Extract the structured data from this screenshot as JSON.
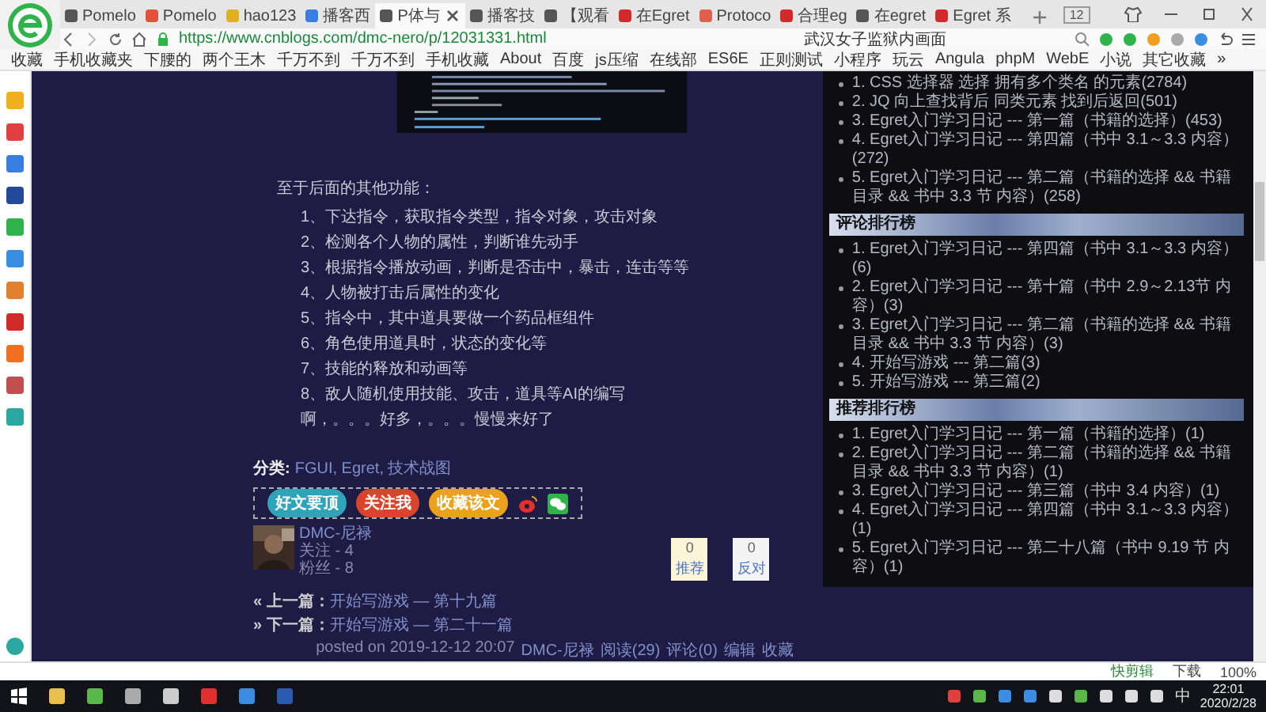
{
  "browser": {
    "tabs": [
      {
        "label": "Pomelo",
        "selected": false
      },
      {
        "label": "Pomelo",
        "selected": false
      },
      {
        "label": "hao123",
        "selected": false
      },
      {
        "label": "播客西",
        "selected": false
      },
      {
        "label": "P体与",
        "selected": true
      },
      {
        "label": "播客技",
        "selected": false
      },
      {
        "label": "【观看",
        "selected": false
      },
      {
        "label": "在Egret",
        "selected": false
      },
      {
        "label": "Protoco",
        "selected": false
      },
      {
        "label": "合理eg",
        "selected": false
      },
      {
        "label": "在egret",
        "selected": false
      },
      {
        "label": "Egret 系",
        "selected": false
      }
    ],
    "tab_count": "12",
    "address": "https://www.cnblogs.com/dmc-nero/p/12031331.html",
    "search": {
      "value": "武汉女子监狱内画面"
    },
    "bookmarks": [
      "收藏",
      "手机收藏夹",
      "下腰的",
      "两个王木",
      "千万不到",
      "千万不到",
      "手机收藏",
      "About",
      "百度",
      "js压缩",
      "在线部",
      "ES6E",
      "正则测试",
      "小程序",
      "玩云",
      "Angula",
      "phpM",
      "WebE",
      "小说",
      "其它收藏",
      "»"
    ]
  },
  "article": {
    "intro": "至于后面的其他功能：",
    "items": [
      "1、下达指令，获取指令类型，指令对象，攻击对象",
      "2、检测各个人物的属性，判断谁先动手",
      "3、根据指令播放动画，判断是否击中，暴击，连击等等",
      "4、人物被打击后属性的变化",
      "5、指令中，其中道具要做一个药品框组件",
      "6、角色使用道具时，状态的变化等",
      "7、技能的释放和动画等",
      "8、敌人随机使用技能、攻击，道具等AI的编写",
      "啊，。。。好多，。。。慢慢来好了"
    ],
    "category_label": "分类:",
    "categories": "FGUI, Egret, 技术战图",
    "share_buttons": [
      {
        "label": "好文要顶",
        "color": "#2fa3b8"
      },
      {
        "label": "关注我",
        "color": "#d9442c"
      },
      {
        "label": "收藏该文",
        "color": "#eaa21c"
      }
    ],
    "author": {
      "name": "DMC-尼禄",
      "following": "关注 - 4",
      "followers": "粉丝 - 8"
    },
    "votes": [
      {
        "count": "0",
        "label": "推荐"
      },
      {
        "count": "0",
        "label": "反对"
      }
    ],
    "prev": {
      "label": "« 上一篇：",
      "title": "开始写游戏 — 第十九篇"
    },
    "next": {
      "label": "» 下一篇：",
      "title": "开始写游戏 — 第二十一篇"
    },
    "footer": {
      "posted": "posted on 2019-12-12 20:07",
      "links": [
        "DMC-尼禄",
        "阅读(29)",
        "评论(0)",
        "编辑",
        "收藏"
      ]
    }
  },
  "sidebar": {
    "sections": [
      {
        "items": [
          "1. CSS 选择器 选择 拥有多个类名 的元素(2784)",
          "2. JQ 向上查找背后 同类元素 找到后返回(501)",
          "3. Egret入门学习日记 --- 第一篇（书籍的选择）(453)",
          "4. Egret入门学习日记 --- 第四篇（书中 3.1～3.3 内容）(272)",
          "5. Egret入门学习日记 --- 第二篇（书籍的选择 && 书籍目录 && 书中 3.3 节 内容）(258)"
        ]
      },
      {
        "title": "评论排行榜",
        "items": [
          "1. Egret入门学习日记 --- 第四篇（书中 3.1～3.3 内容）(6)",
          "2. Egret入门学习日记 --- 第十篇（书中 2.9～2.13节 内容）(3)",
          "3. Egret入门学习日记 --- 第二篇（书籍的选择 && 书籍目录 && 书中 3.3 节 内容）(3)",
          "4. 开始写游戏 --- 第二篇(3)",
          "5. 开始写游戏 --- 第三篇(2)"
        ]
      },
      {
        "title": "推荐排行榜",
        "items": [
          "1. Egret入门学习日记 --- 第一篇（书籍的选择）(1)",
          "2. Egret入门学习日记 --- 第二篇（书籍的选择 && 书籍目录 && 书中 3.3 节 内容）(1)",
          "3. Egret入门学习日记 --- 第三篇（书中 3.4 内容）(1)",
          "4. Egret入门学习日记 --- 第四篇（书中 3.1～3.3 内容）(1)",
          "5. Egret入门学习日记 --- 第二十八篇（书中 9.19 节 内容）(1)"
        ]
      }
    ]
  },
  "status_bar": {
    "items": [
      "快剪辑",
      "下载",
      "100%"
    ]
  },
  "taskbar": {
    "ime": "中",
    "time": "22:01",
    "date": "2020/2/28"
  }
}
